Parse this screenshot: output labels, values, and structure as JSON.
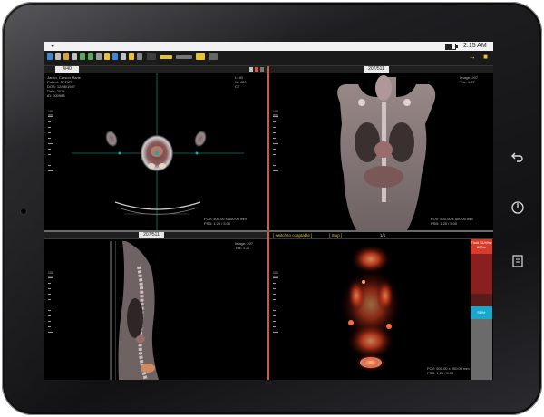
{
  "statusbar": {
    "time": "2:15 AM",
    "wifi_icon": "wifi-icon",
    "battery_level": 0.6
  },
  "toolbar": {
    "tool_icons": [
      "layout-icon",
      "cursor-icon",
      "undo-icon",
      "redo-icon",
      "rotate-icon",
      "pan-icon",
      "zoom-icon",
      "window-level-icon",
      "ruler-icon",
      "annotate-icon",
      "crosshair-icon",
      "grid-icon"
    ],
    "right_icons": [
      "pin-icon",
      "menu-icon"
    ],
    "accent": "#e7c234"
  },
  "panes": {
    "axial": {
      "tab": "4/40",
      "info_left": "Jankn, Carson Marie\nPatient: 3P2M7\nDOB: 12/08/1947\nDate: 2014\nID: 000988",
      "info_right": "L: 40\nW: 400\nCT",
      "footer": "FOV: 500.00 x 500.00 mm\nPSB: 1.25 / 5.00",
      "ruler": "100 mm"
    },
    "coronal": {
      "tab": "207/511",
      "info_right": "Image: 207\nThk: 1.27",
      "footer": "FOV: 500.00 x 500.00 mm\nPSB: 1.25 / 5.00",
      "ruler": "100 mm"
    },
    "sagittal": {
      "tab": "207/511",
      "info_right": "Image: 207\nThk: 1.27",
      "footer": "FOV: 500.00 x 500.00 mm\nPSB: 1.25 / 5.00",
      "ruler": "100 mm"
    },
    "pet": {
      "header_left": "[ switch to coaptable ]",
      "header_mid": "[ Stop ]",
      "tab": "1/1",
      "footer": "FOV: 500.00 x 500.00 mm\nPSB: 1.25 / 5.00",
      "ruler": "100 mm",
      "colorbar": {
        "top_label": "Fluid\nSUVbw\n600m",
        "mid_label": "SUVr",
        "colors": [
          "#d93a2a",
          "#8a1f1f",
          "#5a1b1b",
          "#1aa7c9",
          "#6b6b6b"
        ]
      }
    }
  },
  "hardware": {
    "back_icon": "back-icon",
    "home_icon": "power-icon",
    "menu_icon": "menu-icon"
  }
}
